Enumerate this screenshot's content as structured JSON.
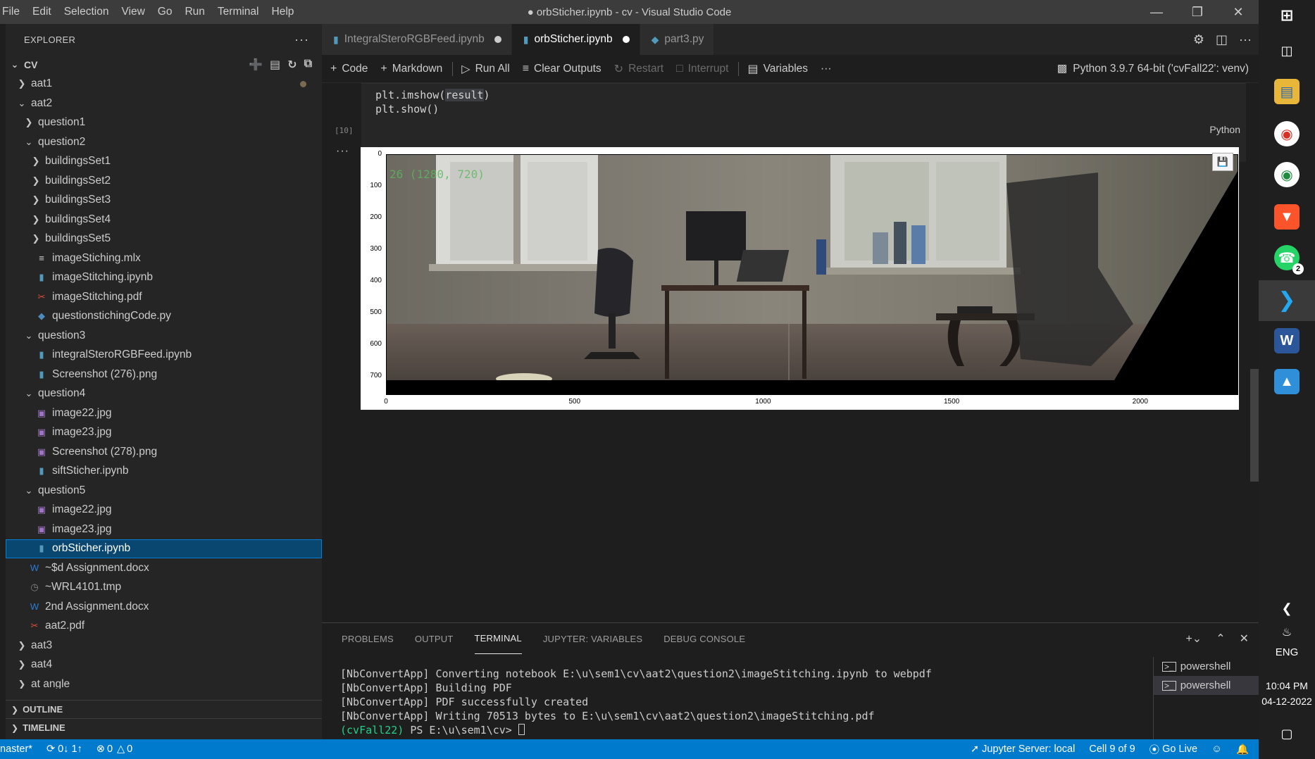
{
  "window": {
    "title": "● orbSticher.ipynb - cv - Visual Studio Code",
    "menu": [
      "File",
      "Edit",
      "Selection",
      "View",
      "Go",
      "Run",
      "Terminal",
      "Help"
    ]
  },
  "explorer": {
    "header": "EXPLORER",
    "root": "CV",
    "items": [
      {
        "label": "aat1",
        "depth": 1,
        "type": "folder",
        "open": false,
        "modified": true
      },
      {
        "label": "aat2",
        "depth": 1,
        "type": "folder",
        "open": true
      },
      {
        "label": "question1",
        "depth": 2,
        "type": "folder",
        "open": false
      },
      {
        "label": "question2",
        "depth": 2,
        "type": "folder",
        "open": true
      },
      {
        "label": "buildingsSet1",
        "depth": 3,
        "type": "folder",
        "open": false
      },
      {
        "label": "buildingsSet2",
        "depth": 3,
        "type": "folder",
        "open": false
      },
      {
        "label": "buildingsSet3",
        "depth": 3,
        "type": "folder",
        "open": false
      },
      {
        "label": "buildingsSet4",
        "depth": 3,
        "type": "folder",
        "open": false
      },
      {
        "label": "buildingsSet5",
        "depth": 3,
        "type": "folder",
        "open": false
      },
      {
        "label": "imageStiching.mlx",
        "depth": 3,
        "type": "mlx"
      },
      {
        "label": "imageStitching.ipynb",
        "depth": 3,
        "type": "notebook"
      },
      {
        "label": "imageStitching.pdf",
        "depth": 3,
        "type": "pdf"
      },
      {
        "label": "questionstichingCode.py",
        "depth": 3,
        "type": "python"
      },
      {
        "label": "question3",
        "depth": 2,
        "type": "folder",
        "open": true
      },
      {
        "label": "integralSteroRGBFeed.ipynb",
        "depth": 3,
        "type": "notebook"
      },
      {
        "label": "Screenshot (276).png",
        "depth": 3,
        "type": "notebook"
      },
      {
        "label": "question4",
        "depth": 2,
        "type": "folder",
        "open": true
      },
      {
        "label": "image22.jpg",
        "depth": 3,
        "type": "image"
      },
      {
        "label": "image23.jpg",
        "depth": 3,
        "type": "image"
      },
      {
        "label": "Screenshot (278).png",
        "depth": 3,
        "type": "image"
      },
      {
        "label": "siftSticher.ipynb",
        "depth": 3,
        "type": "notebook"
      },
      {
        "label": "question5",
        "depth": 2,
        "type": "folder",
        "open": true
      },
      {
        "label": "image22.jpg",
        "depth": 3,
        "type": "image"
      },
      {
        "label": "image23.jpg",
        "depth": 3,
        "type": "image"
      },
      {
        "label": "orbSticher.ipynb",
        "depth": 3,
        "type": "notebook",
        "selected": true
      },
      {
        "label": "~$d Assignment.docx",
        "depth": 2,
        "type": "word"
      },
      {
        "label": "~WRL4101.tmp",
        "depth": 2,
        "type": "tmp"
      },
      {
        "label": "2nd Assignment.docx",
        "depth": 2,
        "type": "word"
      },
      {
        "label": "aat2.pdf",
        "depth": 2,
        "type": "pdf"
      },
      {
        "label": "aat3",
        "depth": 1,
        "type": "folder",
        "open": false
      },
      {
        "label": "aat4",
        "depth": 1,
        "type": "folder",
        "open": false
      },
      {
        "label": "at angle",
        "depth": 1,
        "type": "folder",
        "open": false
      }
    ],
    "outline": "OUTLINE",
    "timeline": "TIMELINE"
  },
  "tabs": [
    {
      "label": "IntegralSteroRGBFeed.ipynb",
      "icon": "notebook-icon",
      "dirty": true,
      "active": false
    },
    {
      "label": "orbSticher.ipynb",
      "icon": "notebook-icon",
      "dirty": true,
      "active": true
    },
    {
      "label": "part3.py",
      "icon": "python-icon",
      "dirty": false,
      "active": false
    }
  ],
  "toolbar": {
    "code": "Code",
    "markdown": "Markdown",
    "run_all": "Run All",
    "clear_outputs": "Clear Outputs",
    "restart": "Restart",
    "interrupt": "Interrupt",
    "variables": "Variables",
    "more": "···",
    "kernel": "Python 3.9.7 64-bit ('cvFall22': venv)"
  },
  "cell": {
    "code_line1_pre": "plt.imshow(",
    "code_line1_hl": "result",
    "code_line1_post": ")",
    "code_line2": "plt.show()",
    "exec_count": "[10]",
    "language": "Python"
  },
  "output": {
    "more": "···",
    "overlay_text": "26 (1280, 720)",
    "y_ticks": [
      "0",
      "100",
      "200",
      "300",
      "400",
      "500",
      "600",
      "700"
    ],
    "x_ticks": [
      "0",
      "500",
      "1000",
      "1500",
      "2000"
    ]
  },
  "panel": {
    "tabs": [
      "PROBLEMS",
      "OUTPUT",
      "TERMINAL",
      "JUPYTER: VARIABLES",
      "DEBUG CONSOLE"
    ],
    "active_tab": "TERMINAL",
    "terminal_lines": [
      "[NbConvertApp] Converting notebook E:\\u\\sem1\\cv\\aat2\\question2\\imageStitching.ipynb to webpdf",
      "[NbConvertApp] Building PDF",
      "[NbConvertApp] PDF successfully created",
      "[NbConvertApp] Writing 70513 bytes to E:\\u\\sem1\\cv\\aat2\\question2\\imageStitching.pdf"
    ],
    "prompt_env": "(cvFall22)",
    "prompt": " PS E:\\u\\sem1\\cv> ",
    "terminals": [
      "powershell",
      "powershell"
    ]
  },
  "statusbar": {
    "branch": "naster*",
    "sync": "0↓ 1↑",
    "errors": "0",
    "warnings": "0",
    "jupyter": "Jupyter Server: local",
    "cell": "Cell 9 of 9",
    "golive": "Go Live"
  },
  "system": {
    "lang": "ENG",
    "time": "10:04 PM",
    "date": "04-12-2022",
    "whatsapp_badge": "2"
  }
}
